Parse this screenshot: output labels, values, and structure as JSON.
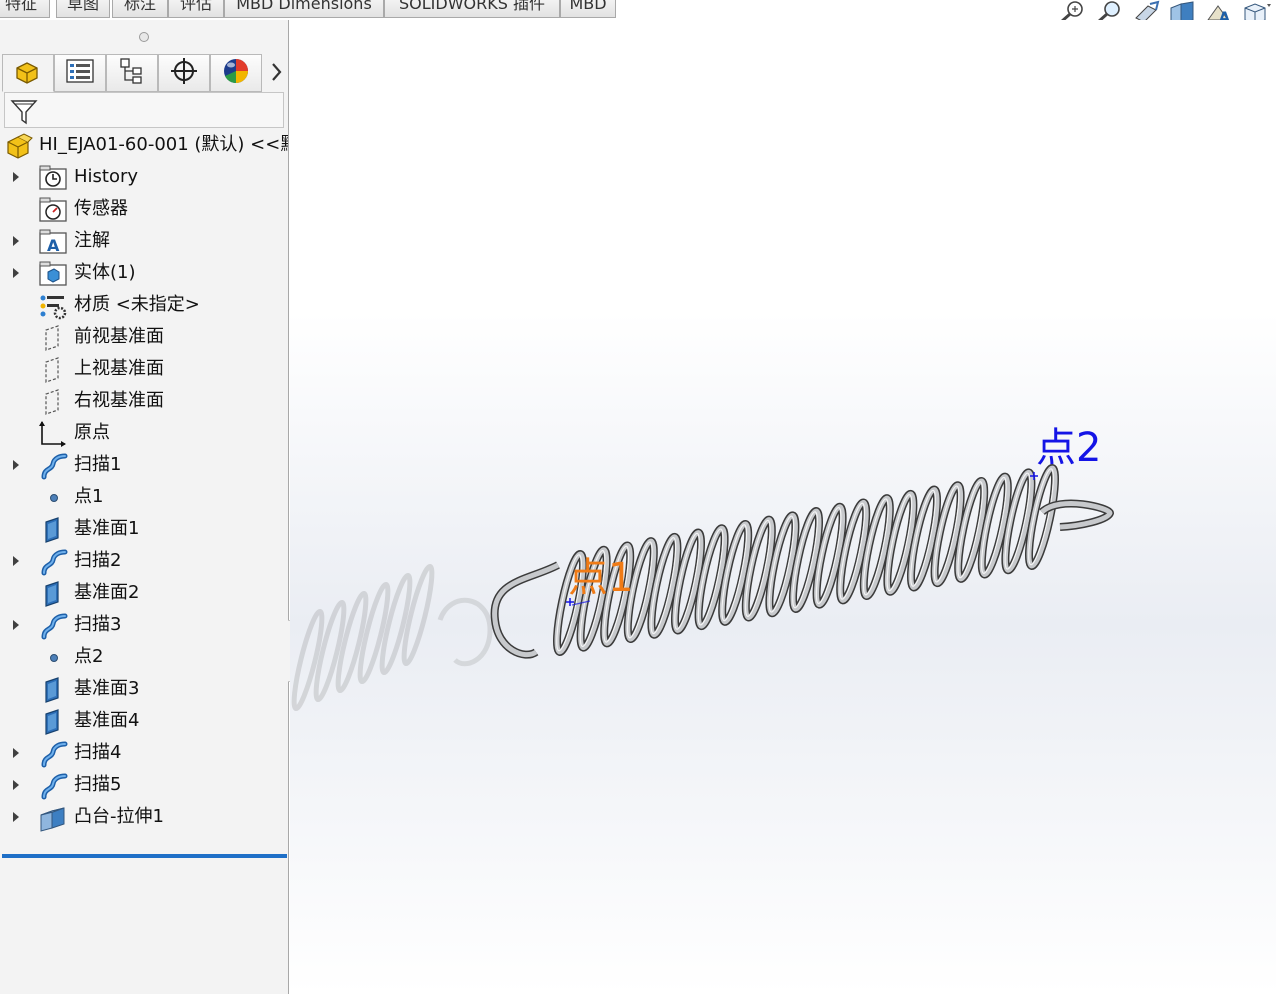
{
  "command_tabs": [
    {
      "label": "特征"
    },
    {
      "label": "草图"
    },
    {
      "label": "标注"
    },
    {
      "label": "评估"
    },
    {
      "label": "MBD Dimensions"
    },
    {
      "label": "SOLIDWORKS 插件"
    },
    {
      "label": "MBD"
    }
  ],
  "heads_up_toolbar": [
    {
      "icon": "zoom-to-fit-icon"
    },
    {
      "icon": "zoom-to-area-icon"
    },
    {
      "icon": "previous-view-icon"
    },
    {
      "icon": "section-view-icon"
    },
    {
      "icon": "annotation-view-icon"
    },
    {
      "icon": "view-orientation-icon"
    }
  ],
  "panel_tabs": [
    {
      "icon": "feature-manager-icon",
      "active": true
    },
    {
      "icon": "property-manager-icon"
    },
    {
      "icon": "configuration-manager-icon"
    },
    {
      "icon": "dimxpert-manager-icon"
    },
    {
      "icon": "display-manager-icon"
    }
  ],
  "feature_tree": [
    {
      "label": "HI_EJA01-60-001 (默认) <<默",
      "icon": "part-icon",
      "expandable": false,
      "root": true
    },
    {
      "label": "History",
      "icon": "history-folder-icon",
      "expandable": true
    },
    {
      "label": "传感器",
      "icon": "sensors-folder-icon",
      "expandable": false
    },
    {
      "label": "注解",
      "icon": "annotations-folder-icon",
      "expandable": true
    },
    {
      "label": "实体(1)",
      "icon": "solid-bodies-folder-icon",
      "expandable": true
    },
    {
      "label": "材质 <未指定>",
      "icon": "material-icon",
      "expandable": false
    },
    {
      "label": "前视基准面",
      "icon": "plane-icon",
      "expandable": false
    },
    {
      "label": "上视基准面",
      "icon": "plane-icon",
      "expandable": false
    },
    {
      "label": "右视基准面",
      "icon": "plane-icon",
      "expandable": false
    },
    {
      "label": "原点",
      "icon": "origin-icon",
      "expandable": false
    },
    {
      "label": "扫描1",
      "icon": "sweep-icon",
      "expandable": true
    },
    {
      "label": "点1",
      "icon": "point-icon",
      "expandable": false
    },
    {
      "label": "基准面1",
      "icon": "ref-plane-icon",
      "expandable": false
    },
    {
      "label": "扫描2",
      "icon": "sweep-icon",
      "expandable": true
    },
    {
      "label": "基准面2",
      "icon": "ref-plane-icon",
      "expandable": false
    },
    {
      "label": "扫描3",
      "icon": "sweep-icon",
      "expandable": true
    },
    {
      "label": "点2",
      "icon": "point-icon",
      "expandable": false
    },
    {
      "label": "基准面3",
      "icon": "ref-plane-icon",
      "expandable": false
    },
    {
      "label": "基准面4",
      "icon": "ref-plane-icon",
      "expandable": false
    },
    {
      "label": "扫描4",
      "icon": "sweep-icon",
      "expandable": true
    },
    {
      "label": "扫描5",
      "icon": "sweep-icon",
      "expandable": true
    },
    {
      "label": "凸台-拉伸1",
      "icon": "extrude-icon",
      "expandable": true
    }
  ],
  "viewport": {
    "callout_point1": "点1",
    "callout_point2": "点2",
    "colors": {
      "point1_label": "#f07b16",
      "point2_label": "#1414e6",
      "spring": "#c7c9cc",
      "spring_edge": "#3b3b3b"
    }
  }
}
